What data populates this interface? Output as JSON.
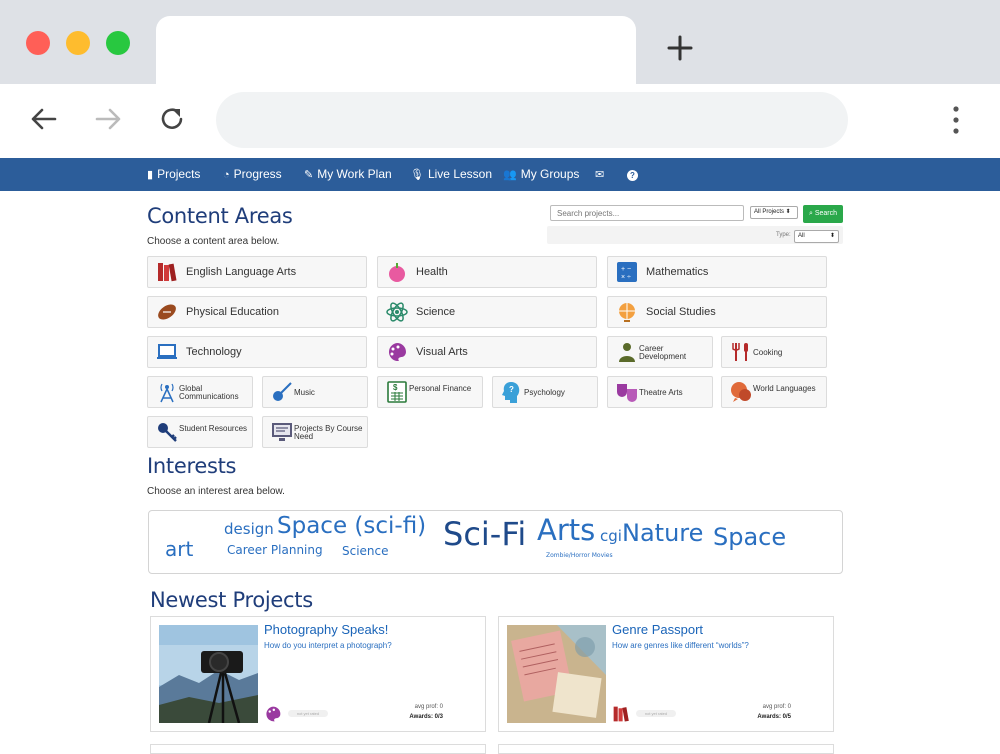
{
  "site_nav": {
    "items": [
      {
        "label": "Projects",
        "icon": "book-icon"
      },
      {
        "label": "Progress",
        "icon": "dashboard-icon"
      },
      {
        "label": "My Work Plan",
        "icon": "pencil-icon"
      },
      {
        "label": "Live Lesson",
        "icon": "microphone-icon"
      },
      {
        "label": "My Groups",
        "icon": "users-icon"
      },
      {
        "label": "",
        "icon": "envelope-icon"
      },
      {
        "label": "",
        "icon": "question-icon"
      }
    ]
  },
  "content_areas": {
    "title": "Content Areas",
    "subtitle": "Choose a content area below.",
    "search": {
      "placeholder": "Search projects...",
      "scope": "All Projects ⬍",
      "button": "Search",
      "type_label": "Type:",
      "type_value": "All"
    },
    "tiles": [
      {
        "label": "English Language Arts",
        "icon": "books-icon"
      },
      {
        "label": "Health",
        "icon": "apple-icon"
      },
      {
        "label": "Mathematics",
        "icon": "calculator-icon"
      },
      {
        "label": "Physical Education",
        "icon": "football-icon"
      },
      {
        "label": "Science",
        "icon": "atom-icon"
      },
      {
        "label": "Social Studies",
        "icon": "globe-icon"
      },
      {
        "label": "Technology",
        "icon": "laptop-icon"
      },
      {
        "label": "Visual Arts",
        "icon": "palette-icon"
      },
      {
        "label": "Career Development",
        "icon": "businessman-icon"
      },
      {
        "label": "Cooking",
        "icon": "utensils-icon"
      },
      {
        "label": "Global Communications",
        "icon": "antenna-icon"
      },
      {
        "label": "Music",
        "icon": "guitar-icon"
      },
      {
        "label": "Personal Finance",
        "icon": "calculator-dollar-icon"
      },
      {
        "label": "Psychology",
        "icon": "head-icon"
      },
      {
        "label": "Theatre Arts",
        "icon": "masks-icon"
      },
      {
        "label": "World Languages",
        "icon": "speech-bubbles-icon"
      },
      {
        "label": "Student Resources",
        "icon": "key-icon"
      },
      {
        "label": "Projects By Course Need",
        "icon": "monitor-icon"
      }
    ]
  },
  "interests": {
    "title": "Interests",
    "subtitle": "Choose an interest area below.",
    "words": [
      "art",
      "design",
      "Space (sci-fi)",
      "Career Planning",
      "Science",
      "Sci-Fi",
      "Arts",
      "cgi",
      "Nature",
      "Zombie/Horror Movies",
      "Space"
    ]
  },
  "newest": {
    "title": "Newest Projects",
    "cards": [
      {
        "title": "Photography Speaks!",
        "question": "How do you interpret a photograph?",
        "avg": "avg prof: 0",
        "awards": "Awards: 0/3",
        "status": "not yet rated"
      },
      {
        "title": "Genre Passport",
        "question": "How are genres like different “worlds”?",
        "avg": "avg prof: 0",
        "awards": "Awards: 0/5",
        "status": "not yet rated"
      }
    ]
  }
}
